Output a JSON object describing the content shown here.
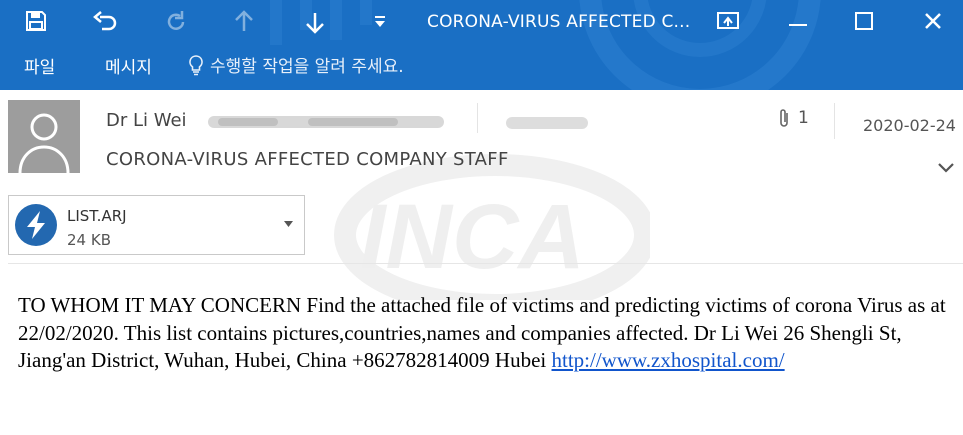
{
  "window": {
    "title": "CORONA-VIRUS AFFECTED C...",
    "quick_access": [
      "save-icon",
      "undo-icon",
      "redo-icon",
      "up-arrow-icon",
      "down-arrow-icon",
      "customize-icon"
    ],
    "controls": [
      "restore-icon",
      "minimize-icon",
      "maximize-icon",
      "close-icon"
    ]
  },
  "ribbon": {
    "tabs": [
      {
        "label": "파일"
      },
      {
        "label": "메시지"
      }
    ],
    "tell_me": "수행할 작업을 알려 주세요."
  },
  "message": {
    "sender": "Dr Li Wei",
    "subject": "CORONA-VIRUS AFFECTED COMPANY STAFF",
    "date": "2020-02-24",
    "attachment_count": "1"
  },
  "attachment": {
    "name": "LIST.ARJ",
    "size": "24 KB"
  },
  "body": {
    "text": "TO WHOM IT MAY CONCERN Find the attached file of victims and predicting victims of corona Virus as at 22/02/2020. This list contains pictures,countries,names and companies affected. Dr Li Wei 26 Shengli St, Jiang'an District, Wuhan, Hubei, China +862782814009 Hubei ",
    "link": "http://www.zxhospital.com/"
  },
  "watermark": {
    "text": "INCA"
  },
  "colors": {
    "ribbon": "#1a6fc4",
    "avatar": "#9d9d9d",
    "attachment_icon": "#2368b0",
    "link": "#1155cc"
  }
}
